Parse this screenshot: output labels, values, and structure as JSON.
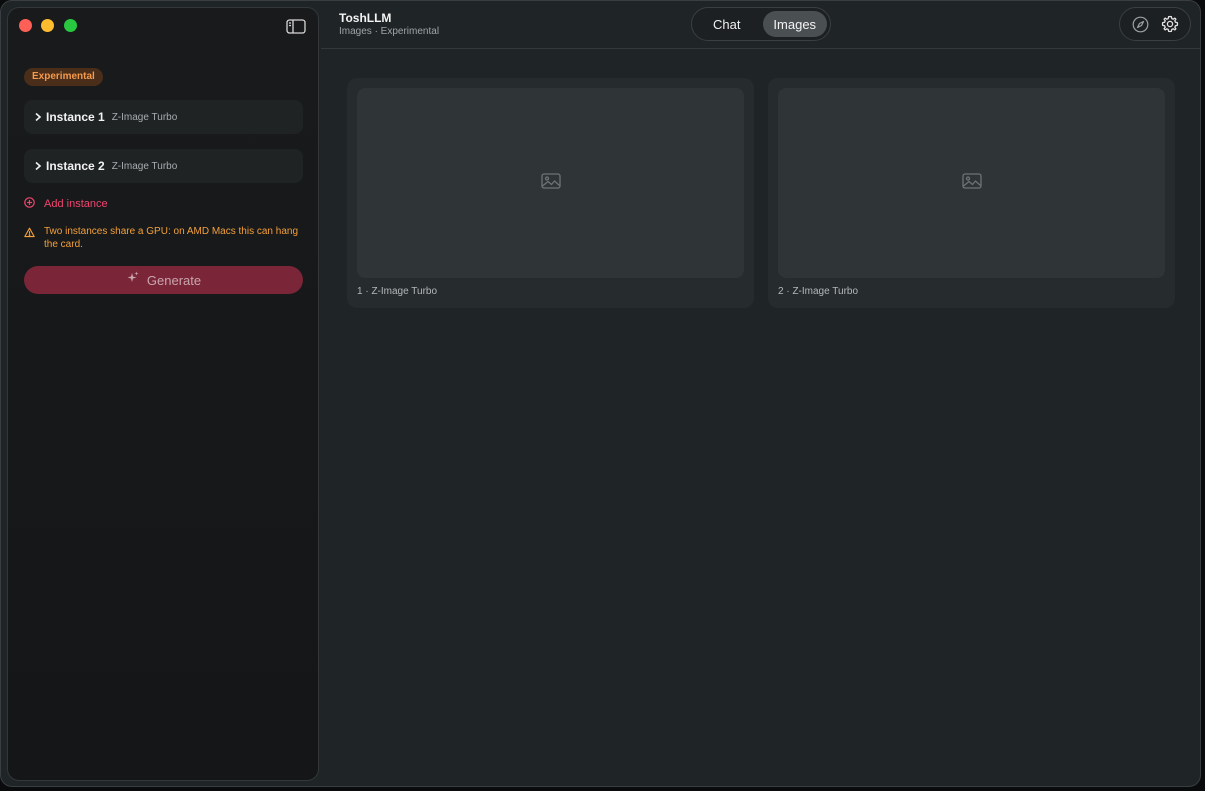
{
  "header": {
    "title": "ToshLLM",
    "subtitle": "Images · Experimental",
    "tabs": [
      {
        "label": "Chat",
        "selected": false
      },
      {
        "label": "Images",
        "selected": true
      }
    ],
    "icons": [
      "compass-icon",
      "gear-icon"
    ]
  },
  "sidebar": {
    "badge": "Experimental",
    "instances": [
      {
        "name": "Instance 1",
        "model": "Z-Image Turbo"
      },
      {
        "name": "Instance 2",
        "model": "Z-Image Turbo"
      }
    ],
    "add_instance_label": "Add instance",
    "warning": "Two instances share a GPU: on AMD Macs this can hang the card.",
    "generate_label": "Generate"
  },
  "main": {
    "outputs": [
      {
        "caption": "1 · Z-Image Turbo"
      },
      {
        "caption": "2 · Z-Image Turbo"
      }
    ]
  },
  "colors": {
    "accent": "#f0456e",
    "generate_bg": "#7a2638",
    "warning": "#f5a03a",
    "badge_text": "#f59a4a"
  }
}
